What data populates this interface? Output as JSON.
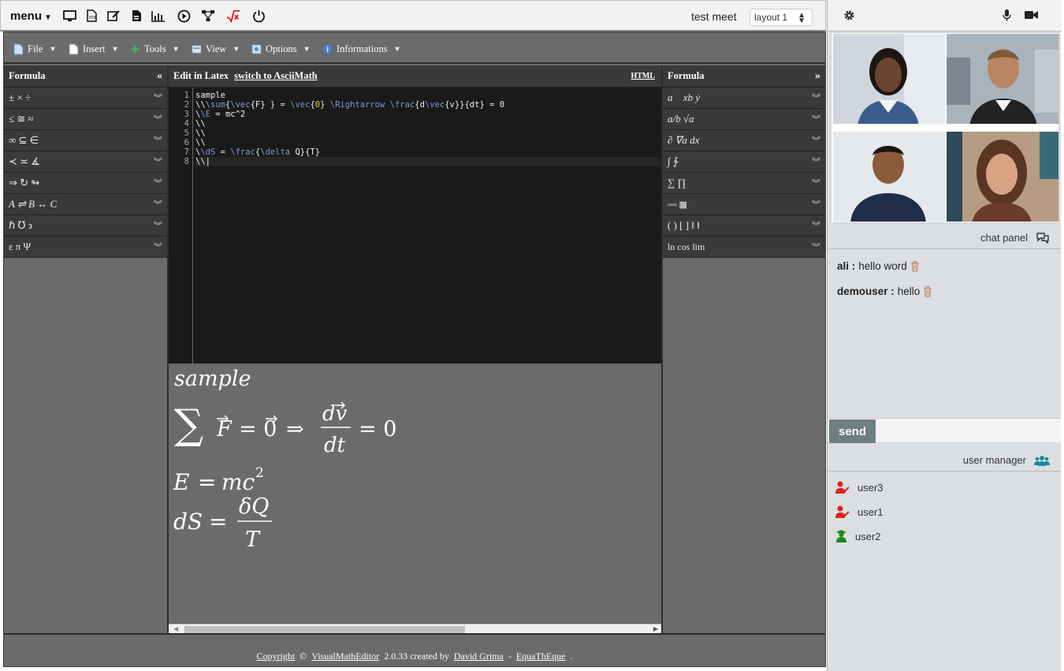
{
  "topbar": {
    "menu_label": "menu",
    "icons": [
      "monitor-icon",
      "pdf-icon",
      "edit-icon",
      "document-icon",
      "chart-icon",
      "play-icon",
      "network-icon",
      "sqrt-icon",
      "power-icon"
    ],
    "meet_title": "test meet",
    "layout_value": "layout 1"
  },
  "menubar": {
    "items": [
      {
        "label": "File",
        "icon": "file-icon"
      },
      {
        "label": "Insert",
        "icon": "insert-icon"
      },
      {
        "label": "Tools",
        "icon": "tools-icon"
      },
      {
        "label": "View",
        "icon": "view-icon"
      },
      {
        "label": "Options",
        "icon": "options-icon"
      },
      {
        "label": "Informations",
        "icon": "info-icon"
      }
    ]
  },
  "left_panel": {
    "title": "Formula",
    "rows": [
      "± × ÷",
      "≤ ≅ ≈",
      "∞ ⊆ ∈",
      "≺ ≍ ∡",
      "⇒ ↻ ↬",
      "A ⇌ B ↔ C",
      "ℏ ℧ ϶",
      "ε π Ψ"
    ]
  },
  "center": {
    "mode_label": "Edit in Latex",
    "switch_link": "switch to AsciiMath",
    "html_link": "HTML",
    "line_numbers": [
      "1",
      "2",
      "3",
      "4",
      "5",
      "6",
      "7",
      "8"
    ]
  },
  "right_panel": {
    "title": "Formula",
    "rows": [
      "a⃗ xb ẏ",
      "a/b √a",
      "∂ ∇a dx",
      "∫ ∱",
      "∑ ∏",
      "▫▫▫ ▦",
      "( ) [ ] ‖ ‖",
      "ln cos lim"
    ]
  },
  "rendered": {
    "line1": "sample"
  },
  "footer": {
    "copyright": "Copyright",
    "symbol": "©",
    "app": "VisualMathEditor",
    "version": "2.0.33 created by",
    "author": "David Grima",
    "dash": "-",
    "site": "EquaThEque",
    "dot": "."
  },
  "chat": {
    "title": "chat panel",
    "messages": [
      {
        "user": "ali :",
        "text": "hello word"
      },
      {
        "user": "demouser :",
        "text": "hello"
      }
    ],
    "send_label": "send"
  },
  "users": {
    "title": "user manager",
    "list": [
      {
        "name": "user3",
        "role": "editor",
        "color": "#e02020"
      },
      {
        "name": "user1",
        "role": "editor",
        "color": "#e02020"
      },
      {
        "name": "user2",
        "role": "teacher",
        "color": "#1a8a1a"
      }
    ]
  },
  "colors": {
    "panel": "#6b6b6b",
    "panel_dark": "#3a3a3a",
    "sidebar": "#dcdfe2",
    "send_button": "#6f7f80",
    "users_icon": "#1a8a9a"
  }
}
